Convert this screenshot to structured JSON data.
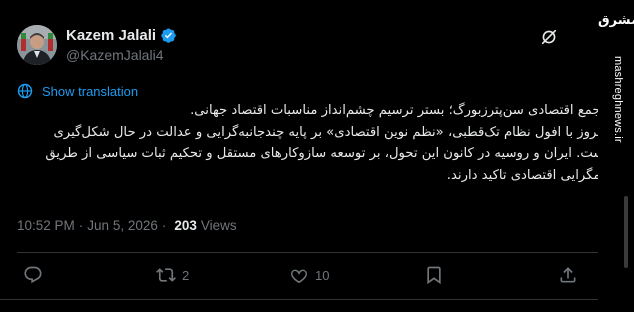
{
  "author": {
    "name": "Kazem Jalali",
    "handle": "@KazemJalali4"
  },
  "translate": {
    "label": "Show translation"
  },
  "tweet": {
    "paragraph1": "مجمع اقتصادی سن‌پترزبورگ؛ بستر ترسیم چشم‌انداز مناسبات اقتصاد جهانی.",
    "paragraph2": "امروز با افول نظام تک‌قطبی، «نظم نوین اقتصادی» بر پایه چندجانبه‌گرایی و عدالت در حال شکل‌گیری است. ایران و روسیه در کانون این تحول، بر توسعه سازوکارهای مستقل و تحکیم ثبات سیاسی از طریق همگرایی اقتصادی تاکید دارند."
  },
  "meta": {
    "time": "10:52 PM",
    "separator": "·",
    "date": "Jun 5, 2026",
    "views_count": "203",
    "views_label": "Views"
  },
  "actions": {
    "reply_count": "",
    "retweet_count": "2",
    "like_count": "10"
  },
  "watermark": {
    "logo": "مشرق",
    "url": "mashreghnews.ir"
  },
  "colors": {
    "accent": "#1d9bf0",
    "muted": "#71767b",
    "text": "#e7e9ea",
    "background": "#000000"
  },
  "icons": [
    "verified-badge-icon",
    "grok-icon",
    "translate-icon",
    "reply-icon",
    "retweet-icon",
    "like-icon",
    "share-icon"
  ]
}
